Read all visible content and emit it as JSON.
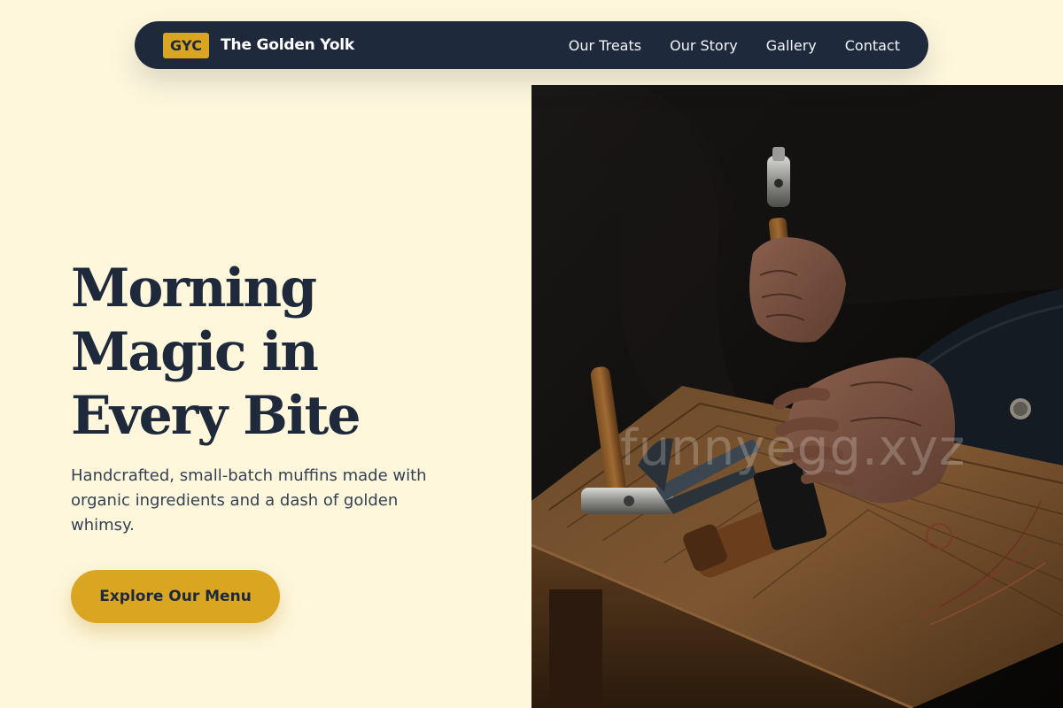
{
  "nav": {
    "brand_badge": "GYC",
    "brand_name": "The Golden Yolk",
    "links": [
      "Our Treats",
      "Our Story",
      "Gallery",
      "Contact"
    ]
  },
  "hero": {
    "title": "Morning Magic in Every Bite",
    "subtitle": "Handcrafted, small-batch muffins made with organic ingredients and a dash of golden whimsy.",
    "cta_label": "Explore Our Menu",
    "image_description": "A craftsman's weathered hands holding a small hammer over a rustic wooden workbench with a mallet, pliers and wire.",
    "watermark": "funnyegg.xyz"
  },
  "colors": {
    "background": "#fef7dc",
    "navbar": "#1e293b",
    "accent_gold": "#daa520",
    "heading": "#1e293b",
    "body_text": "#334155"
  }
}
